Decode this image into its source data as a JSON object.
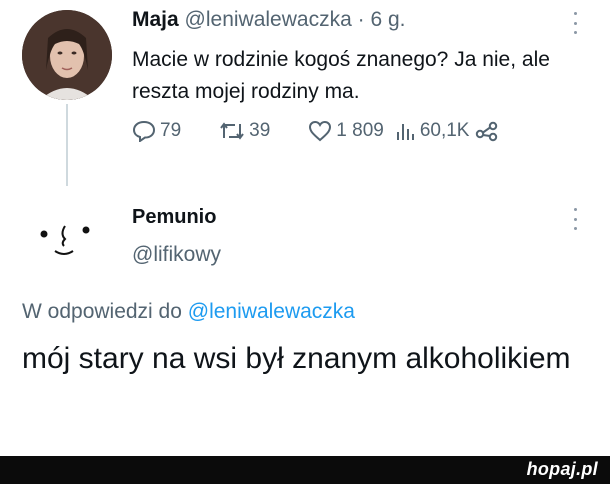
{
  "tweet": {
    "author_name": "Maja",
    "author_handle": "@leniwalewaczka",
    "separator": "·",
    "time": "6 g.",
    "text": "Macie w rodzinie kogoś znanego? Ja nie, ale reszta mojej rodziny ma.",
    "actions": {
      "replies": "79",
      "retweets": "39",
      "likes": "1 809",
      "views": "60,1K"
    }
  },
  "reply": {
    "author_name": "Pemunio",
    "author_handle": "@lifikowy",
    "reply_prefix": "W odpowiedzi do",
    "reply_mention": "@leniwalewaczka",
    "text": "mój stary na wsi był znanym alkoholikiem"
  },
  "footer": {
    "brand": "hopaj.pl"
  },
  "colors": {
    "primary_text": "#0f1419",
    "secondary_text": "#536471",
    "link": "#1d9bf0",
    "footer_bg": "#0b0b0b"
  },
  "icons": [
    "reply-icon",
    "retweet-icon",
    "like-icon",
    "views-icon",
    "share-icon",
    "more-icon"
  ]
}
